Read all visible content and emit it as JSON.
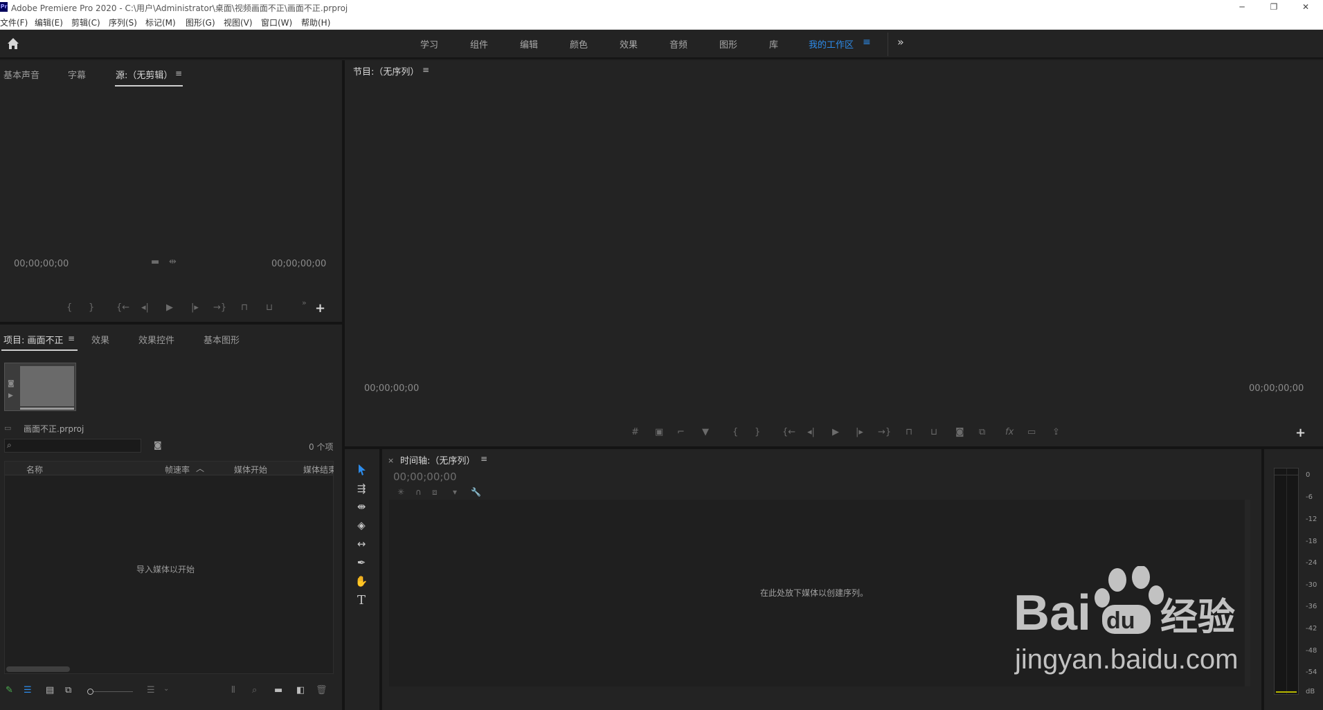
{
  "window": {
    "title": "Adobe Premiere Pro 2020 - C:\\用户\\Administrator\\桌面\\视频画面不正\\画面不正.prproj",
    "logo": "Pr",
    "controls": [
      "─",
      "❐",
      "✕"
    ]
  },
  "menu": [
    "文件(F)",
    "编辑(E)",
    "剪辑(C)",
    "序列(S)",
    "标记(M)",
    "图形(G)",
    "视图(V)",
    "窗口(W)",
    "帮助(H)"
  ],
  "workspaces": {
    "items": [
      "学习",
      "组件",
      "编辑",
      "颜色",
      "效果",
      "音频",
      "图形",
      "库",
      "我的工作区"
    ],
    "active": "我的工作区",
    "menu_icon": "≡",
    "more": "»"
  },
  "source_panel": {
    "tabs": [
      "基本声音",
      "字幕",
      "源:（无剪辑）"
    ],
    "menu_icon": "≡",
    "timecode_left": "00;00;00;00",
    "timecode_right": "00;00;00;00"
  },
  "program_panel": {
    "title": "节目:（无序列）",
    "menu_icon": "≡",
    "timecode_left": "00;00;00;00",
    "timecode_right": "00;00;00;00"
  },
  "project_panel": {
    "tabs": [
      "项目: 画面不正",
      "效果",
      "效果控件",
      "基本图形"
    ],
    "menu_icon": "≡",
    "file_name": "画面不正.prproj",
    "item_count": "0 个项",
    "columns": [
      "名称",
      "帧速率",
      "媒体开始",
      "媒体结束"
    ],
    "sort_indicator": "︿",
    "empty_message": "导入媒体以开始"
  },
  "timeline_panel": {
    "close": "×",
    "title": "时间轴:（无序列）",
    "menu_icon": "≡",
    "timecode": "00;00;00;00",
    "drop_message": "在此处放下媒体以创建序列。"
  },
  "tools": [
    "selection-tool",
    "track-select-tool",
    "ripple-edit-tool",
    "razor-tool",
    "slip-tool",
    "pen-tool",
    "hand-tool",
    "type-tool"
  ],
  "audio_meter": {
    "scale": [
      "0",
      "-6",
      "-12",
      "-18",
      "-24",
      "-30",
      "-36",
      "-42",
      "-48",
      "-54",
      "dB"
    ]
  },
  "watermark": {
    "brand": "Bai du 经验",
    "url": "jingyan.baidu.com"
  },
  "colors": {
    "accent": "#2d8ceb",
    "panel_bg": "#232323",
    "gutter": "#141414"
  }
}
